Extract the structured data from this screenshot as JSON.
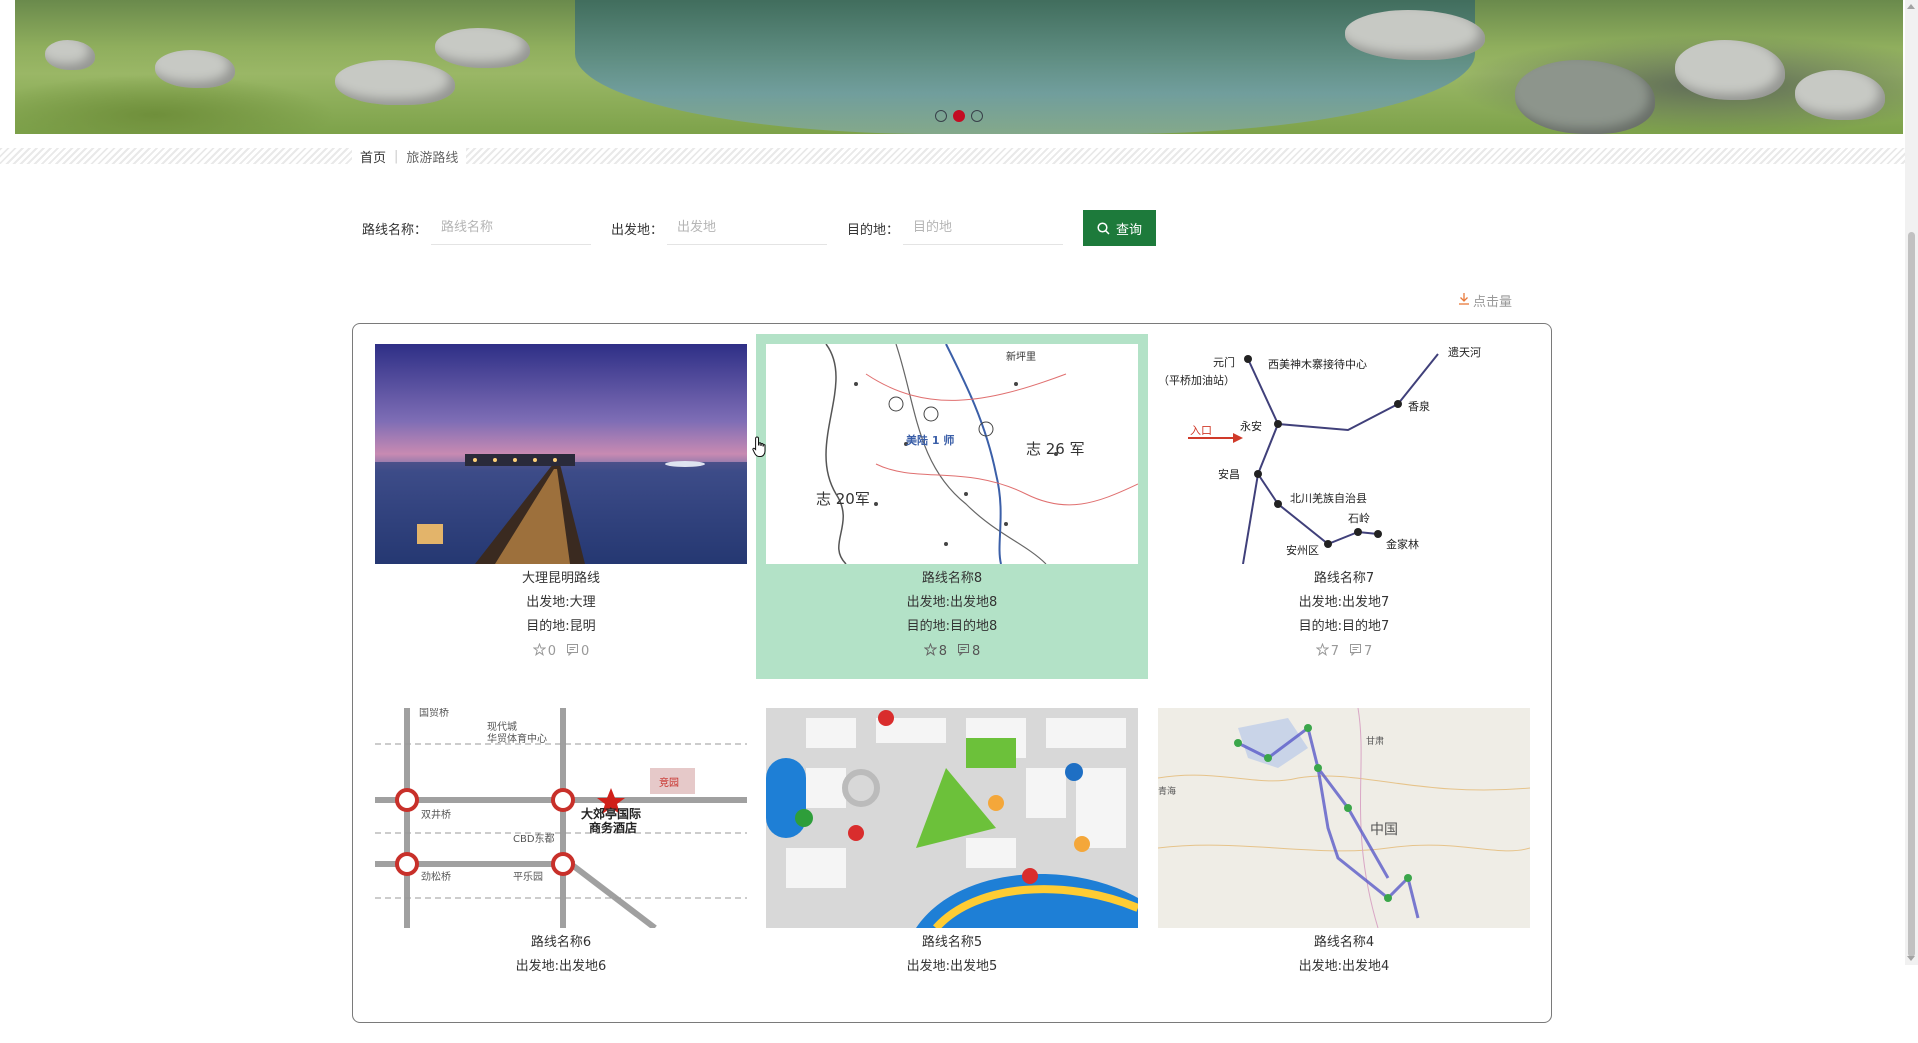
{
  "banner": {
    "slides": 3,
    "active_slide": 2,
    "colors": {
      "active_dot": "#c30d23"
    }
  },
  "breadcrumb": {
    "home": "首页",
    "separator": "|",
    "current": "旅游路线"
  },
  "search": {
    "name_label": "路线名称：",
    "name_placeholder": "路线名称",
    "from_label": "出发地：",
    "from_placeholder": "出发地",
    "to_label": "目的地：",
    "to_placeholder": "目的地",
    "button_label": "查询",
    "button_icon": "search-icon",
    "button_color": "#1d7a3b"
  },
  "sort": {
    "label": "点击量",
    "icon": "download-icon"
  },
  "routes": [
    {
      "name": "大理昆明路线",
      "from": "出发地:大理",
      "to": "目的地:昆明",
      "likes": "0",
      "comments": "0",
      "thumb": "sunset-pier"
    },
    {
      "name": "路线名称8",
      "from": "出发地:出发地8",
      "to": "目的地:目的地8",
      "likes": "8",
      "comments": "8",
      "thumb": "military-map"
    },
    {
      "name": "路线名称7",
      "from": "出发地:出发地7",
      "to": "目的地:目的地7",
      "likes": "7",
      "comments": "7",
      "thumb": "route-diagram"
    },
    {
      "name": "路线名称6",
      "from": "出发地:出发地6",
      "to": "",
      "likes": "",
      "comments": "",
      "thumb": "city-metro-map"
    },
    {
      "name": "路线名称5",
      "from": "出发地:出发地5",
      "to": "",
      "likes": "",
      "comments": "",
      "thumb": "city-pin-map"
    },
    {
      "name": "路线名称4",
      "from": "出发地:出发地4",
      "to": "",
      "likes": "",
      "comments": "",
      "thumb": "china-route-map"
    }
  ],
  "map_labels": {
    "m8": [
      "志 26 军",
      "志 20军",
      "新坪里",
      "美陆 1 师"
    ],
    "m7": [
      "遗天河",
      "元门",
      "西美神木寨接待中心",
      "（平桥加油站）",
      "入口",
      "永安",
      "香泉",
      "安昌",
      "北川羌族自治县",
      "石岭",
      "安州区",
      "金家林"
    ],
    "m6": [
      "国贸桥",
      "现代城",
      "华贸体育中心",
      "大郊亭国际",
      "商务酒店",
      "竞园",
      "双井桥",
      "CBD东都",
      "劲松桥",
      "平乐园"
    ],
    "m4": [
      "中国",
      "青海",
      "甘肃"
    ]
  },
  "accent_colors": {
    "hover_card": "#b3e2c7",
    "border": "#7a7a7a"
  }
}
